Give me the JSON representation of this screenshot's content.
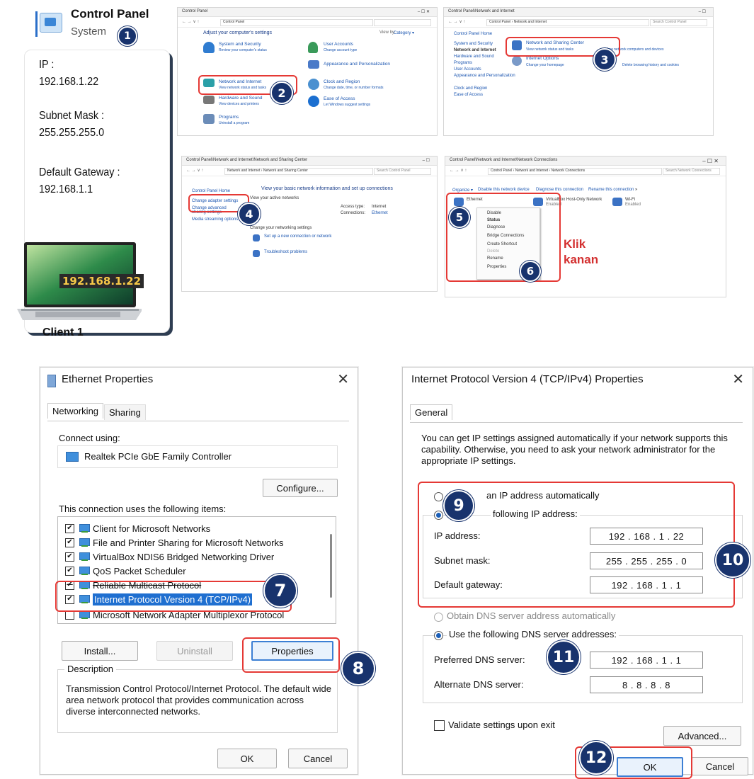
{
  "control_panel_badge": {
    "title": "Control Panel",
    "subtitle": "System",
    "step": "1"
  },
  "client_info": {
    "ip_label": "IP :",
    "ip_value": "192.168.1.22",
    "subnet_label": "Subnet Mask :",
    "subnet_value": "255.255.255.0",
    "gateway_label": "Default Gateway :",
    "gateway_value": "192.168.1.1",
    "laptop_ip": "192.168.1.22",
    "client_name": "Client 1"
  },
  "steps": {
    "s2": "2",
    "s3": "3",
    "s4": "4",
    "s5": "5",
    "s6": "6",
    "s7": "7",
    "s8": "8",
    "s9": "9",
    "s10": "10",
    "s11": "11",
    "s12": "12"
  },
  "annotation": {
    "klik": "Klik",
    "kanan": "kanan"
  },
  "cp_window": {
    "title": "Control Panel",
    "address": "Control Panel",
    "header": "Adjust your computer's settings",
    "view_by": "View by:",
    "view_value": "Category ▾",
    "items_left": [
      {
        "title": "System and Security",
        "desc": "Review your computer's status"
      },
      {
        "title": "Network and Internet",
        "desc": "View network status and tasks"
      },
      {
        "title": "Hardware and Sound",
        "desc": "View devices and printers"
      },
      {
        "title": "Programs",
        "desc": "Uninstall a program"
      }
    ],
    "items_right": [
      {
        "title": "User Accounts",
        "desc": "Change account type"
      },
      {
        "title": "Appearance and Personalization",
        "desc": ""
      },
      {
        "title": "Clock and Region",
        "desc": "Change date, time, or number formats"
      },
      {
        "title": "Ease of Access",
        "desc": "Let Windows suggest settings"
      }
    ]
  },
  "ni_window": {
    "title": "Control Panel\\Network and Internet",
    "address": "Control Panel › Network and Internet",
    "search": "Search Control Panel",
    "sidebar": [
      "Control Panel Home",
      "System and Security",
      "Network and Internet",
      "Hardware and Sound",
      "Programs",
      "User Accounts",
      "Appearance and Personalization",
      "Clock and Region",
      "Ease of Access"
    ],
    "main_title": "Network and Sharing Center",
    "main_link": "View network status and tasks",
    "main_link2": "View network computers and devices",
    "sub_title": "Internet Options",
    "sub_link": "Change your homepage",
    "sub_link2": "Delete browsing history and cookies"
  },
  "nsc_window": {
    "title": "Control Panel\\Network and Internet\\Network and Sharing Center",
    "address": "Network and Internet › Network and Sharing Center",
    "search": "Search Control Panel",
    "sidebar": [
      "Control Panel Home",
      "Change adapter settings",
      "Change advanced sharing settings",
      "Media streaming options"
    ],
    "main_title": "View your basic network information and set up connections",
    "active": "View your active networks",
    "access_type_label": "Access type:",
    "access_type": "Internet",
    "connections_label": "Connections:",
    "connections": "Ethernet",
    "change": "Change your networking settings",
    "setup": "Set up a new connection or network",
    "trouble": "Troubleshoot problems"
  },
  "nc_window": {
    "title": "Control Panel\\Network and Internet\\Network Connections",
    "address": "Control Panel › Network and Internet › Network Connections",
    "search": "Search Network Connections",
    "toolbar": [
      "Organize ▾",
      "Disable this network device",
      "Diagnose this connection",
      "Rename this connection",
      "»"
    ],
    "adapters": [
      {
        "name": "Ethernet",
        "sub": "Enabled"
      },
      {
        "name": "VirtualBox Host-Only Network",
        "sub": "Enabled"
      },
      {
        "name": "Wi-Fi",
        "sub": "Enabled"
      }
    ],
    "menu": [
      "Disable",
      "Status",
      "Diagnose",
      "Bridge Connections",
      "Create Shortcut",
      "Delete",
      "Rename",
      "Properties"
    ]
  },
  "eth_dialog": {
    "title": "Ethernet Properties",
    "tabs": [
      "Networking",
      "Sharing"
    ],
    "connect_using": "Connect using:",
    "adapter": "Realtek PCIe GbE Family Controller",
    "configure": "Configure...",
    "items_label": "This connection uses the following items:",
    "items": [
      "Client for Microsoft Networks",
      "File and Printer Sharing for Microsoft Networks",
      "VirtualBox NDIS6 Bridged Networking Driver",
      "QoS Packet Scheduler",
      "Reliable Multicast Protocol",
      "Internet Protocol Version 4 (TCP/IPv4)",
      "Microsoft Network Adapter Multiplexor Protocol"
    ],
    "install": "Install...",
    "uninstall": "Uninstall",
    "properties": "Properties",
    "description_label": "Description",
    "description": "Transmission Control Protocol/Internet Protocol. The default wide area network protocol that provides communication across diverse interconnected networks.",
    "ok": "OK",
    "cancel": "Cancel"
  },
  "ipv4_dialog": {
    "title": "Internet Protocol Version 4 (TCP/IPv4) Properties",
    "tab": "General",
    "intro": "You can get IP settings assigned automatically if your network supports this capability. Otherwise, you need to ask your network administrator for the appropriate IP settings.",
    "obtain_ip": "an IP address automatically",
    "use_ip": "following IP address:",
    "ip_label": "IP address:",
    "ip_value": "192 . 168 .  1  . 22",
    "mask_label": "Subnet mask:",
    "mask_value": "255 . 255 . 255 .  0",
    "gw_label": "Default gateway:",
    "gw_value": "192 . 168 .  1  .  1",
    "obtain_dns": "Obtain DNS server address automatically",
    "use_dns": "Use the following DNS server addresses:",
    "pref_label": "Preferred DNS server:",
    "pref_value": "192 . 168 .  1  .  1",
    "alt_label": "Alternate DNS server:",
    "alt_value": "8  .  8  .  8  .  8",
    "validate": "Validate settings upon exit",
    "advanced": "Advanced...",
    "ok": "OK",
    "cancel": "Cancel"
  }
}
